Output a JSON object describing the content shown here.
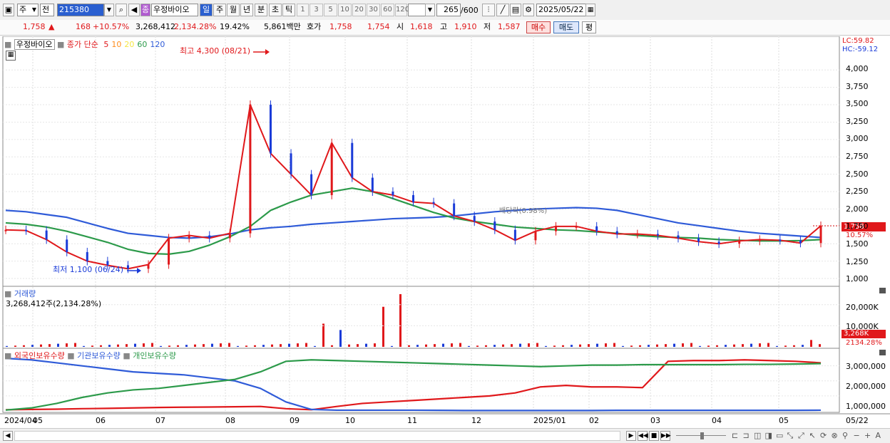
{
  "toolbar": {
    "type_select": "주",
    "prefix_select": "전",
    "stock_code": "215380",
    "stock_badge": "종",
    "stock_name": "우정바이오",
    "periods": [
      "일",
      "주",
      "월",
      "년",
      "분",
      "초",
      "틱"
    ],
    "intervals": [
      "1",
      "3",
      "5",
      "10",
      "20",
      "30",
      "60",
      "120"
    ],
    "count_value": "265",
    "count_max": "/600",
    "date_value": "2025/05/22"
  },
  "quote": {
    "price": "1,758",
    "change": "168",
    "change_pct": "+10.57%",
    "volume": "3,268,412",
    "volume_pct": "2,134.28%",
    "turnover_pct": "19.42%",
    "amount": "5,861백만",
    "bid_label": "호가",
    "ask_price": "1,758",
    "bid_price": "1,754",
    "open_label": "시",
    "open": "1,618",
    "high_label": "고",
    "high": "1,910",
    "low_label": "저",
    "low": "1,587",
    "buy_label": "매수",
    "sell_label": "매도",
    "eval_label": "평"
  },
  "price_panel": {
    "stock_label": "우정바이오",
    "legend_prefix": "종가 단순",
    "ma_periods": [
      "5",
      "10",
      "20",
      "60",
      "120"
    ],
    "ma_colors": [
      "#e0181b",
      "#ff8c1a",
      "#f5e642",
      "#2c9a4a",
      "#2f5bd8"
    ],
    "lc": "LC:59.82",
    "hc": "HC:-59.12",
    "max_label": "최고 4,300 (08/21)",
    "min_label": "최저 1,100 (06/24)",
    "current_tag": "1,758",
    "current_pct": "10.57%",
    "y_labels": [
      "4,000",
      "3,750",
      "3,500",
      "3,250",
      "3,000",
      "2,750",
      "2,500",
      "2,250",
      "2,000",
      "1,750",
      "1,500",
      "1,250",
      "1,000"
    ],
    "faded_annotation": "배당락(0.98%)"
  },
  "volume_panel": {
    "title": "거래량",
    "summary": "3,268,412주(2,134.28%)",
    "y_labels": [
      "20,000K",
      "10,000K"
    ],
    "current_tag": "3,268K",
    "current_pct": "2134.28%"
  },
  "holder_panel": {
    "legend": [
      "외국인보유수량",
      "기관보유수량",
      "개인보유수량"
    ],
    "legend_colors": [
      "#e0181b",
      "#2f5bd8",
      "#2c9a4a"
    ],
    "y_labels": [
      "3,000,000",
      "2,000,000",
      "1,000,000"
    ]
  },
  "x_axis": [
    "2024/04",
    "05",
    "06",
    "07",
    "08",
    "09",
    "10",
    "11",
    "12",
    "2025/01",
    "02",
    "03",
    "04",
    "05"
  ],
  "x_axis_right": "05/22",
  "chart_data": [
    {
      "type": "line",
      "title": "",
      "series": [
        {
          "name": "종가",
          "values": [
            1700,
            1690,
            1560,
            1380,
            1250,
            1190,
            1140,
            1200,
            1580,
            1620,
            1580,
            1650,
            3500,
            2800,
            2500,
            2200,
            2950,
            2450,
            2250,
            2200,
            2100,
            2080,
            1900,
            1820,
            1700,
            1550,
            1680,
            1750,
            1750,
            1680,
            1640,
            1640,
            1620,
            1580,
            1530,
            1500,
            1540,
            1560,
            1550,
            1510,
            1758
          ]
        },
        {
          "name": "60",
          "values": [
            1800,
            1780,
            1740,
            1680,
            1600,
            1520,
            1420,
            1360,
            1350,
            1390,
            1480,
            1600,
            1750,
            1980,
            2100,
            2200,
            2250,
            2300,
            2250,
            2150,
            2050,
            1950,
            1870,
            1820,
            1780,
            1740,
            1720,
            1700,
            1690,
            1670,
            1650,
            1620,
            1600,
            1590,
            1580,
            1560,
            1550,
            1540,
            1540,
            1545,
            1560
          ]
        },
        {
          "name": "120",
          "values": [
            1980,
            1960,
            1920,
            1880,
            1800,
            1720,
            1650,
            1620,
            1590,
            1580,
            1600,
            1640,
            1700,
            1730,
            1750,
            1780,
            1800,
            1820,
            1840,
            1860,
            1870,
            1880,
            1900,
            1930,
            1960,
            1980,
            2000,
            2010,
            2020,
            2010,
            1980,
            1920,
            1860,
            1800,
            1760,
            1720,
            1680,
            1650,
            1630,
            1610,
            1590
          ]
        }
      ],
      "ylim": [
        1000,
        4300
      ]
    },
    {
      "type": "bar",
      "title": "",
      "peak_values_k": [
        11000,
        8000,
        19000,
        25000,
        3268
      ],
      "ylim": [
        0,
        25000
      ]
    },
    {
      "type": "line",
      "title": "",
      "series": [
        {
          "name": "외국인보유수량",
          "values": [
            80000,
            100000,
            120000,
            150000,
            170000,
            200000,
            230000,
            250000,
            260000,
            280000,
            300000,
            150000,
            80000,
            300000,
            500000,
            600000,
            700000,
            800000,
            900000,
            1000000,
            1200000,
            1600000,
            1700000,
            1600000,
            1600000,
            1550000,
            3300000,
            3350000,
            3350000,
            3400000,
            3350000,
            3300000,
            3200000
          ]
        },
        {
          "name": "기관보유수량",
          "values": [
            3500000,
            3400000,
            3200000,
            3000000,
            2800000,
            2600000,
            2500000,
            2400000,
            2200000,
            2000000,
            1500000,
            600000,
            100000,
            50000,
            50000,
            50000,
            50000,
            40000,
            30000,
            30000,
            30000,
            30000,
            30000,
            30000,
            40000,
            40000,
            40000,
            40000,
            40000,
            40000,
            40000,
            40000,
            50000
          ]
        },
        {
          "name": "개인보유수량",
          "values": [
            60000,
            200000,
            500000,
            900000,
            1200000,
            1400000,
            1500000,
            1700000,
            1900000,
            2100000,
            2600000,
            3300000,
            3400000,
            3350000,
            3300000,
            3250000,
            3200000,
            3150000,
            3100000,
            3050000,
            3000000,
            2950000,
            3000000,
            3050000,
            3050000,
            3080000,
            3080000,
            3080000,
            3080000,
            3100000,
            3100000,
            3120000,
            3150000
          ]
        }
      ],
      "ylim": [
        0,
        3600000
      ]
    }
  ]
}
